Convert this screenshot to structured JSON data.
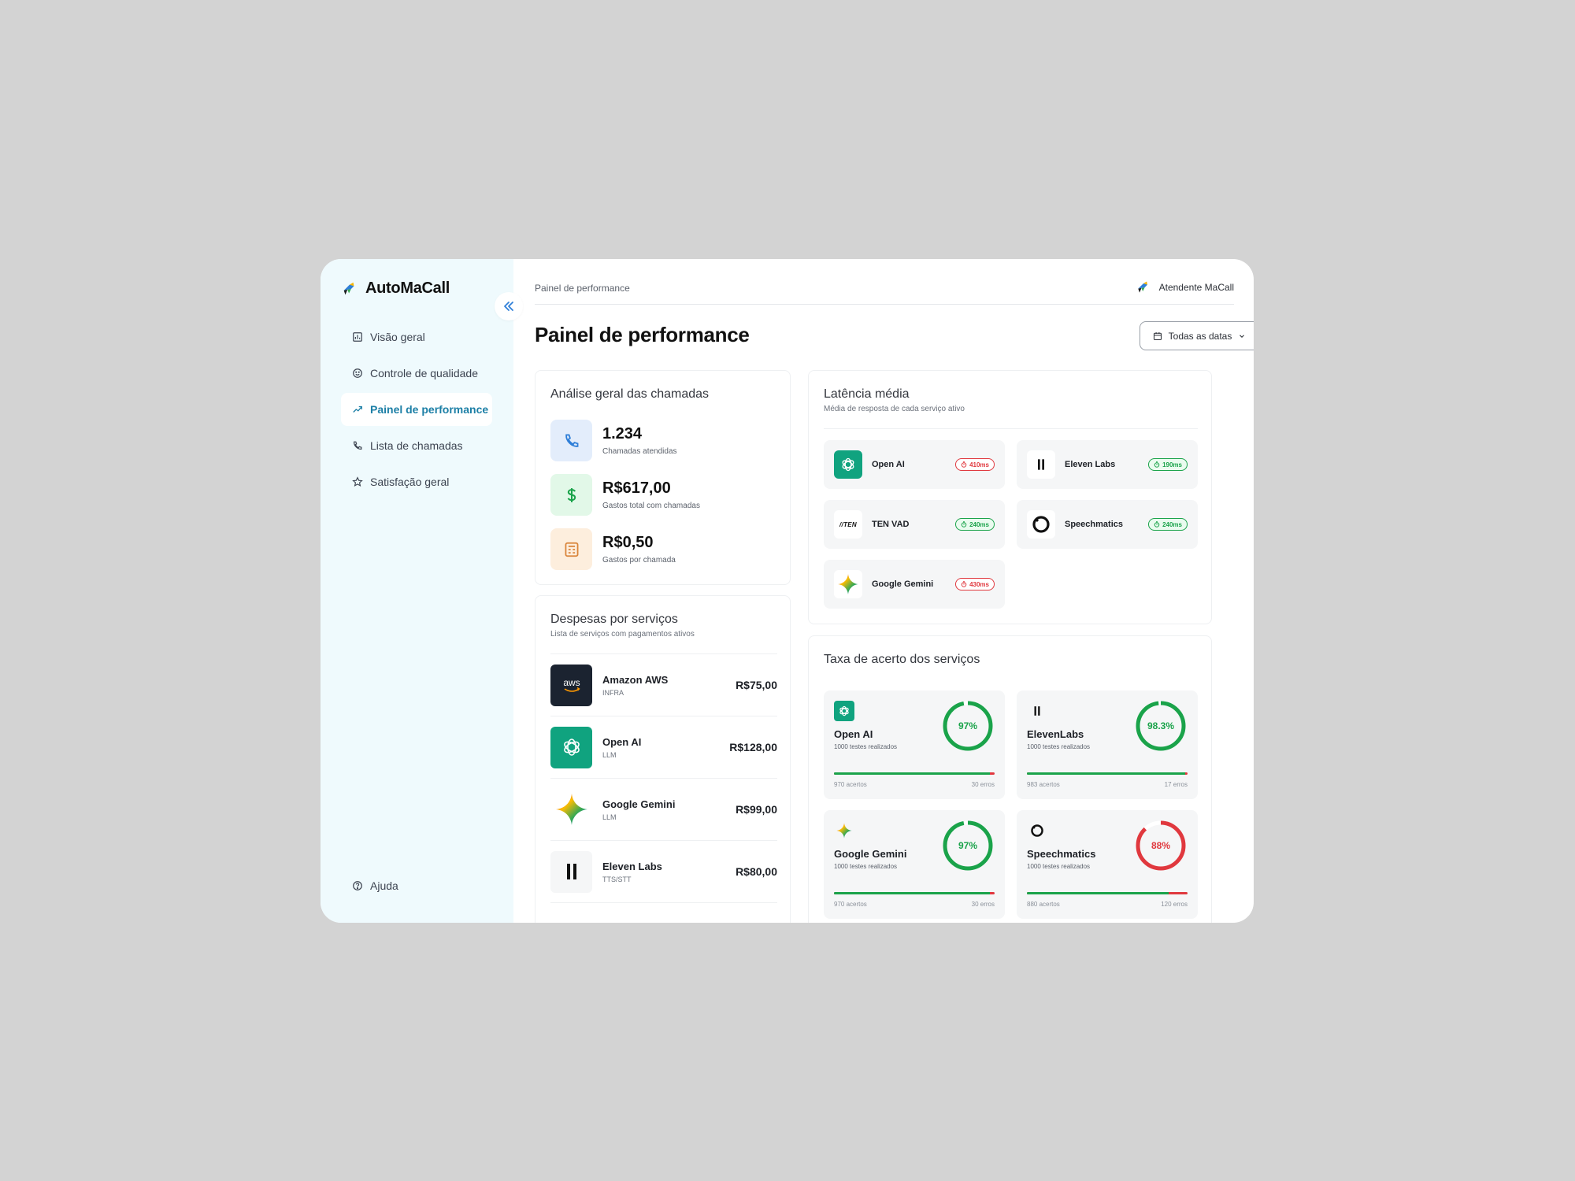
{
  "app": {
    "name": "AutoMaCall"
  },
  "sidebar": {
    "items": [
      {
        "label": "Visão geral"
      },
      {
        "label": "Controle de qualidade"
      },
      {
        "label": "Painel de performance"
      },
      {
        "label": "Lista de chamadas"
      },
      {
        "label": "Satisfação geral"
      }
    ],
    "help_label": "Ajuda"
  },
  "header": {
    "breadcrumb": "Painel de performance",
    "user_name": "Atendente MaCall",
    "page_title": "Painel de performance",
    "date_filter": "Todas as datas"
  },
  "analysis": {
    "title": "Análise geral das chamadas",
    "stats": [
      {
        "value": "1.234",
        "label": "Chamadas atendidas",
        "color": "#e3edfb"
      },
      {
        "value": "R$617,00",
        "label": "Gastos total com chamadas",
        "color": "#e2f8e8"
      },
      {
        "value": "R$0,50",
        "label": "Gastos por chamada",
        "color": "#fdeedd"
      }
    ]
  },
  "expenses": {
    "title": "Despesas por serviços",
    "subtitle": "Lista de serviços com pagamentos ativos",
    "items": [
      {
        "name": "Amazon AWS",
        "category": "INFRA",
        "price": "R$75,00",
        "icon": "aws-logo"
      },
      {
        "name": "Open AI",
        "category": "LLM",
        "price": "R$128,00",
        "icon": "openai-logo"
      },
      {
        "name": "Google Gemini",
        "category": "LLM",
        "price": "R$99,00",
        "icon": "gemini-logo"
      },
      {
        "name": "Eleven Labs",
        "category": "TTS/STT",
        "price": "R$80,00",
        "icon": "elevenlabs-logo"
      }
    ]
  },
  "latency": {
    "title": "Latência média",
    "subtitle": "Média de resposta de cada serviço ativo",
    "items": [
      {
        "name": "Open AI",
        "value": "410ms",
        "status": "bad"
      },
      {
        "name": "Eleven Labs",
        "value": "190ms",
        "status": "good"
      },
      {
        "name": "TEN VAD",
        "value": "240ms",
        "status": "good"
      },
      {
        "name": "Speechmatics",
        "value": "240ms",
        "status": "good"
      },
      {
        "name": "Google Gemini",
        "value": "430ms",
        "status": "bad"
      }
    ],
    "ten_logo_text": "TEN"
  },
  "accuracy": {
    "title": "Taxa de acerto dos serviços",
    "items": [
      {
        "name": "Open AI",
        "tests": "1000 testes realizados",
        "rate_label": "97%",
        "rate": 0.97,
        "hits": "970 acertos",
        "errors": "30 erros",
        "color": "#1aa34a"
      },
      {
        "name": "ElevenLabs",
        "tests": "1000 testes realizados",
        "rate_label": "98.3%",
        "rate": 0.983,
        "hits": "983 acertos",
        "errors": "17 erros",
        "color": "#1aa34a"
      },
      {
        "name": "Google Gemini",
        "tests": "1000 testes realizados",
        "rate_label": "97%",
        "rate": 0.97,
        "hits": "970 acertos",
        "errors": "30 erros",
        "color": "#1aa34a"
      },
      {
        "name": "Speechmatics",
        "tests": "1000 testes realizados",
        "rate_label": "88%",
        "rate": 0.88,
        "hits": "880 acertos",
        "errors": "120 erros",
        "color": "#e0383e"
      }
    ]
  },
  "colors": {
    "accent": "#1c7fa6",
    "good": "#1aa34a",
    "bad": "#e0383e",
    "openai": "#10a37f",
    "aws": "#1b2330"
  }
}
